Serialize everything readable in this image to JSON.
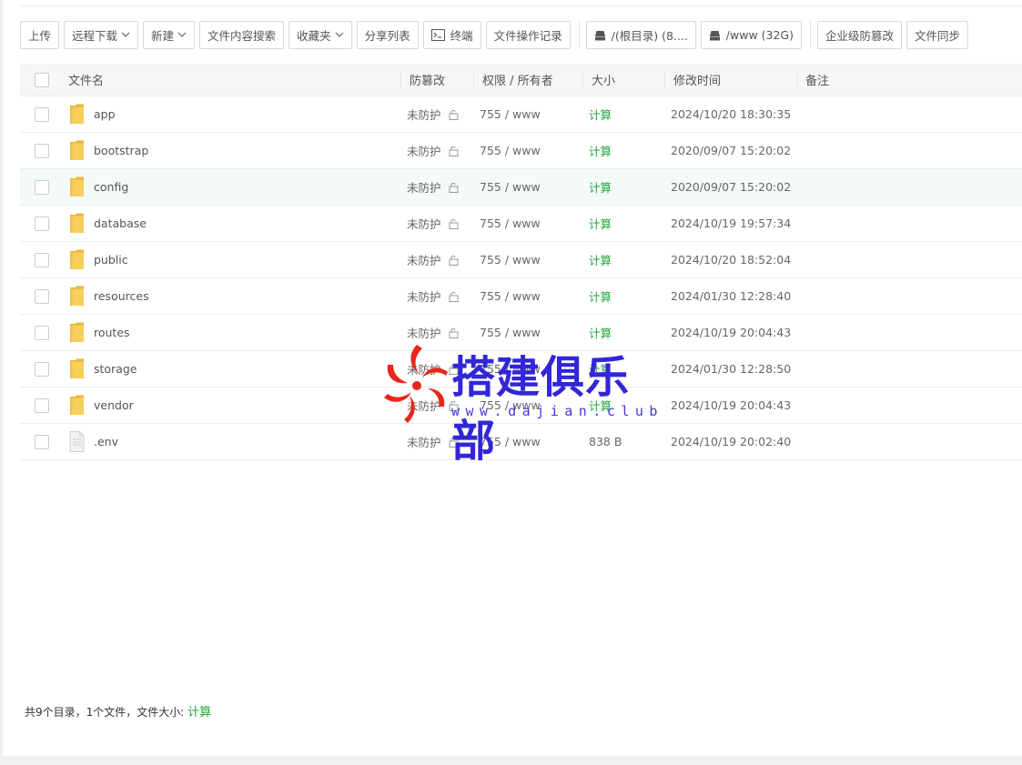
{
  "toolbar": {
    "upload": "上传",
    "remote_download": "远程下载",
    "new": "新建",
    "content_search": "文件内容搜索",
    "favorites": "收藏夹",
    "share_list": "分享列表",
    "terminal": "终端",
    "operation_log": "文件操作记录",
    "disk_root": "/(根目录) (8....",
    "disk_www": "/www (32G)",
    "enterprise_tamper": "企业级防篡改",
    "file_sync": "文件同步"
  },
  "table": {
    "headers": {
      "name": "文件名",
      "tamper": "防篡改",
      "permission": "权限 / 所有者",
      "size": "大小",
      "mtime": "修改时间",
      "note": "备注"
    },
    "rows": [
      {
        "name": "app",
        "type": "folder",
        "tamper": "未防护",
        "permission": "755 / www",
        "size": "计算",
        "mtime": "2024/10/20 18:30:35",
        "highlight": false
      },
      {
        "name": "bootstrap",
        "type": "folder",
        "tamper": "未防护",
        "permission": "755 / www",
        "size": "计算",
        "mtime": "2020/09/07 15:20:02",
        "highlight": false
      },
      {
        "name": "config",
        "type": "folder",
        "tamper": "未防护",
        "permission": "755 / www",
        "size": "计算",
        "mtime": "2020/09/07 15:20:02",
        "highlight": true
      },
      {
        "name": "database",
        "type": "folder",
        "tamper": "未防护",
        "permission": "755 / www",
        "size": "计算",
        "mtime": "2024/10/19 19:57:34",
        "highlight": false
      },
      {
        "name": "public",
        "type": "folder",
        "tamper": "未防护",
        "permission": "755 / www",
        "size": "计算",
        "mtime": "2024/10/20 18:52:04",
        "highlight": false
      },
      {
        "name": "resources",
        "type": "folder",
        "tamper": "未防护",
        "permission": "755 / www",
        "size": "计算",
        "mtime": "2024/01/30 12:28:40",
        "highlight": false
      },
      {
        "name": "routes",
        "type": "folder",
        "tamper": "未防护",
        "permission": "755 / www",
        "size": "计算",
        "mtime": "2024/10/19 20:04:43",
        "highlight": false
      },
      {
        "name": "storage",
        "type": "folder",
        "tamper": "未防护",
        "permission": "755 / www",
        "size": "计算",
        "mtime": "2024/01/30 12:28:50",
        "highlight": false
      },
      {
        "name": "vendor",
        "type": "folder",
        "tamper": "未防护",
        "permission": "755 / www",
        "size": "计算",
        "mtime": "2024/10/19 20:04:43",
        "highlight": false
      },
      {
        "name": ".env",
        "type": "file",
        "tamper": "未防护",
        "permission": "755 / www",
        "size": "838 B",
        "mtime": "2024/10/19 20:02:40",
        "highlight": false
      }
    ]
  },
  "footer": {
    "summary": "共9个目录，1个文件，文件大小: ",
    "calc": "计算"
  },
  "watermark": {
    "title": "搭建俱乐部",
    "url": "www.dajian.club"
  },
  "colors": {
    "accent_green": "#20a53a",
    "watermark_blue": "#3226d8",
    "watermark_red": "#e8261c",
    "folder_yellow": "#f5c542"
  }
}
